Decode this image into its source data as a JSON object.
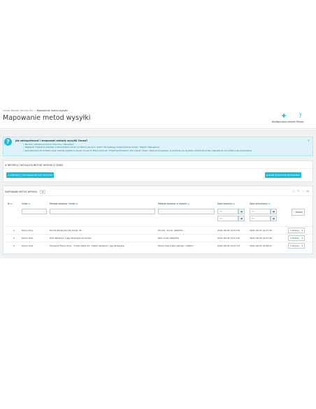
{
  "breadcrumb": {
    "parent": "Ceneo Basket Service Pro",
    "separator": "/",
    "current": "Mapowanie metod wysyłki"
  },
  "page_title": "Mapowanie metod wysyłki",
  "toolbar": {
    "config_label": "Konfiguracja modułu",
    "help_label": "Pomoc"
  },
  "alert": {
    "title": "Jak zaimportować i zmapować metody wysyłki Ceneo?",
    "items": [
      "Naciśnij niebieski przycisk \"Importuj / Aktualizuj\"",
      "Nastąpiło odpytanie katalogu przewoźników Ceneo (w Twoim panelu) i wybór dla katalogu przewoźników Ceneo, \"Zapisz mapowanie\"",
      "Jeśli włączysz lub dodasz nową metodę wysyłki w panelu Ceneo to kliknij przycisk \"Importuj/Aktualizuj\" aby pobrać nowe i stare jej zmapować, w przeciwnym wypadku zamówienia bez mapowania nie zostaną zaimportowane"
    ],
    "close": "×"
  },
  "import_panel": {
    "heading": "IMPORTUJ / AKTUALIZUJ METODY WYSYŁKI Z CENEO",
    "import_button": "IMPORTUJ / AKTUALIZUJ METODY WYSYŁKI",
    "delete_button": "USUŃ WSZYSTKIE MAPOWANIA"
  },
  "list_panel": {
    "heading": "MAPOWANIE METOD WYSYŁKI",
    "count": "3",
    "columns": {
      "id": "Id",
      "shop": "Sklep",
      "ceneo_method": "Metoda dostawy Ceneo",
      "shop_method": "Metoda dostawy w sklepie",
      "date_add": "Data dodania",
      "date_upd": "Data aktualizacji"
    },
    "filters": {
      "shop_value": "--",
      "shop_method_value": "--",
      "from_placeholder": "Od",
      "to_placeholder": "Do",
      "search_button": "Szukaj"
    },
    "rows": [
      {
        "id": "1",
        "shop": "Mi-kuchnie",
        "ceneo": "Poczta Polska,Poczta Kurier 24",
        "shop_method": "Poczta - Kurier (GRATIS)",
        "date_add": "2021-09-03 14:57:59",
        "date_upd": "2021-09-03 14:57:43",
        "edit": "Edytuj"
      },
      {
        "id": "2",
        "shop": "Mi-kuchnie",
        "ceneo": "DHL Wielkość 1 gby,Przesyłka kurierska",
        "shop_method": "DHL kurier (GRATIS)",
        "date_add": "2021-09-03 14:57:26",
        "date_upd": "2021-09-03 14:57:56",
        "edit": "Edytuj"
      },
      {
        "id": "3",
        "shop": "Mi-kuchnie",
        "ceneo": "Transport Mi-kuchnie - TYLKO 0824-03 >500m,Wielkość i gby,Przesyłka",
        "shop_method": "Mi-kuchnie (tylko bezdev >500m)",
        "date_add": "2021-09-03 14:07:33",
        "date_upd": "2021-09-03 14:08:07",
        "edit": "Edytuj"
      }
    ]
  },
  "colors": {
    "accent": "#25b9d7",
    "background": "#eff1f2",
    "alert_bg": "#dcf4f9"
  }
}
